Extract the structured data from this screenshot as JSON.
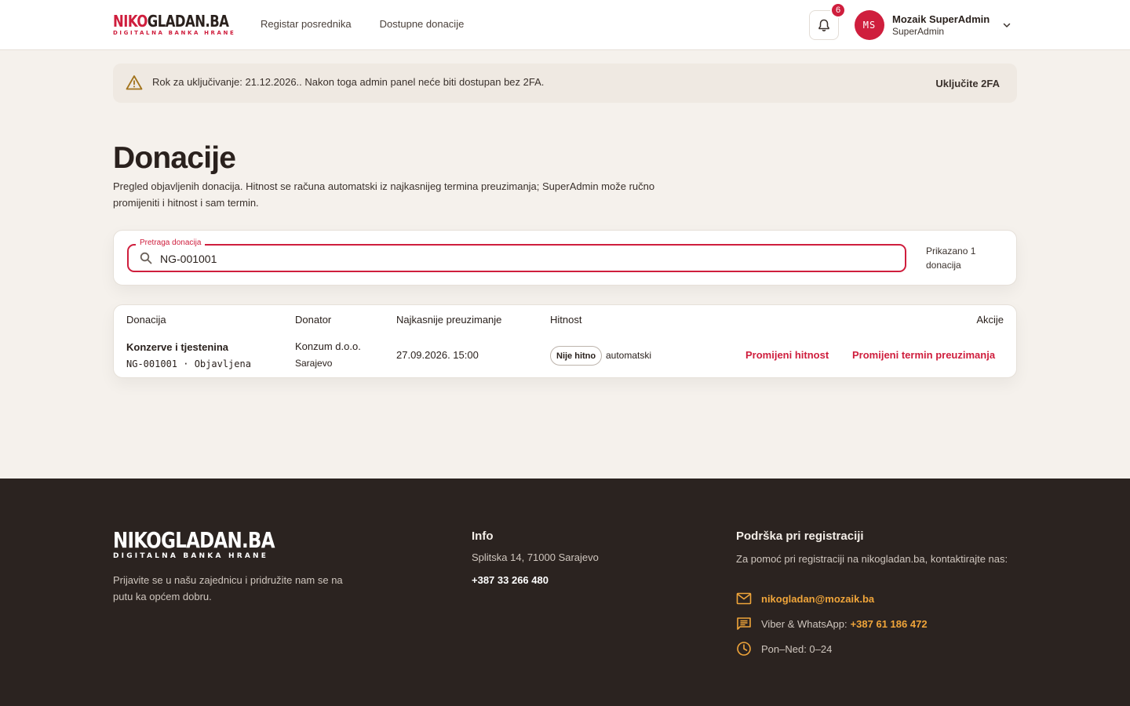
{
  "header": {
    "logo_main_red": "NIKO",
    "logo_main_dark": "GLADAN.BA",
    "logo_sub": "DIGITALNA BANKA HRANE",
    "nav": [
      {
        "label": "Registar posrednika"
      },
      {
        "label": "Dostupne donacije"
      }
    ],
    "notifications_count": "6",
    "user": {
      "initials": "MS",
      "name": "Mozaik SuperAdmin",
      "role": "SuperAdmin"
    }
  },
  "alert": {
    "text": "Rok za uključivanje: 21.12.2026.. Nakon toga admin panel neće biti dostupan bez 2FA.",
    "action": "Uključite 2FA"
  },
  "page": {
    "title": "Donacije",
    "description": "Pregled objavljenih donacija. Hitnost se računa automatski iz najkasnijeg termina preuzimanja; SuperAdmin može ručno promijeniti i hitnost i sam termin."
  },
  "search": {
    "label": "Pretraga donacija",
    "value": "NG-001001",
    "count_text": "Prikazano 1 donacija"
  },
  "table": {
    "headers": {
      "donacija": "Donacija",
      "donator": "Donator",
      "preuzimanje": "Najkasnije preuzimanje",
      "hitnost": "Hitnost",
      "akcije": "Akcije"
    },
    "rows": [
      {
        "title": "Konzerve i tjestenina",
        "code_status": "NG-001001 · Objavljena",
        "donor_name": "Konzum d.o.o.",
        "donor_city": "Sarajevo",
        "pickup": "27.09.2026. 15:00",
        "urgency": "Nije hitno",
        "urgency_mode": "automatski",
        "action_urgency": "Promijeni hitnost",
        "action_pickup": "Promijeni termin preuzimanja"
      }
    ]
  },
  "footer": {
    "logo_main": "NIKOGLADAN.BA",
    "logo_sub": "DIGITALNA BANKA HRANE",
    "tagline": "Prijavite se u našu zajednicu i pridružite nam se na putu ka općem dobru.",
    "info_title": "Info",
    "address": "Splitska 14, 71000 Sarajevo",
    "phone": "+387 33 266 480",
    "support_title": "Podrška pri registraciji",
    "support_text": "Za pomoć pri registraciji na nikogladan.ba, kontaktirajte nas:",
    "email": "nikogladan@mozaik.ba",
    "viber_label": "Viber & WhatsApp: ",
    "viber_number": "+387 61 186 472",
    "hours": "Pon–Ned: 0–24"
  },
  "colors": {
    "brand_red": "#cf1e3d",
    "footer_bg": "#2b2320",
    "footer_accent": "#f0a53a",
    "page_bg": "#f5f1ec"
  }
}
